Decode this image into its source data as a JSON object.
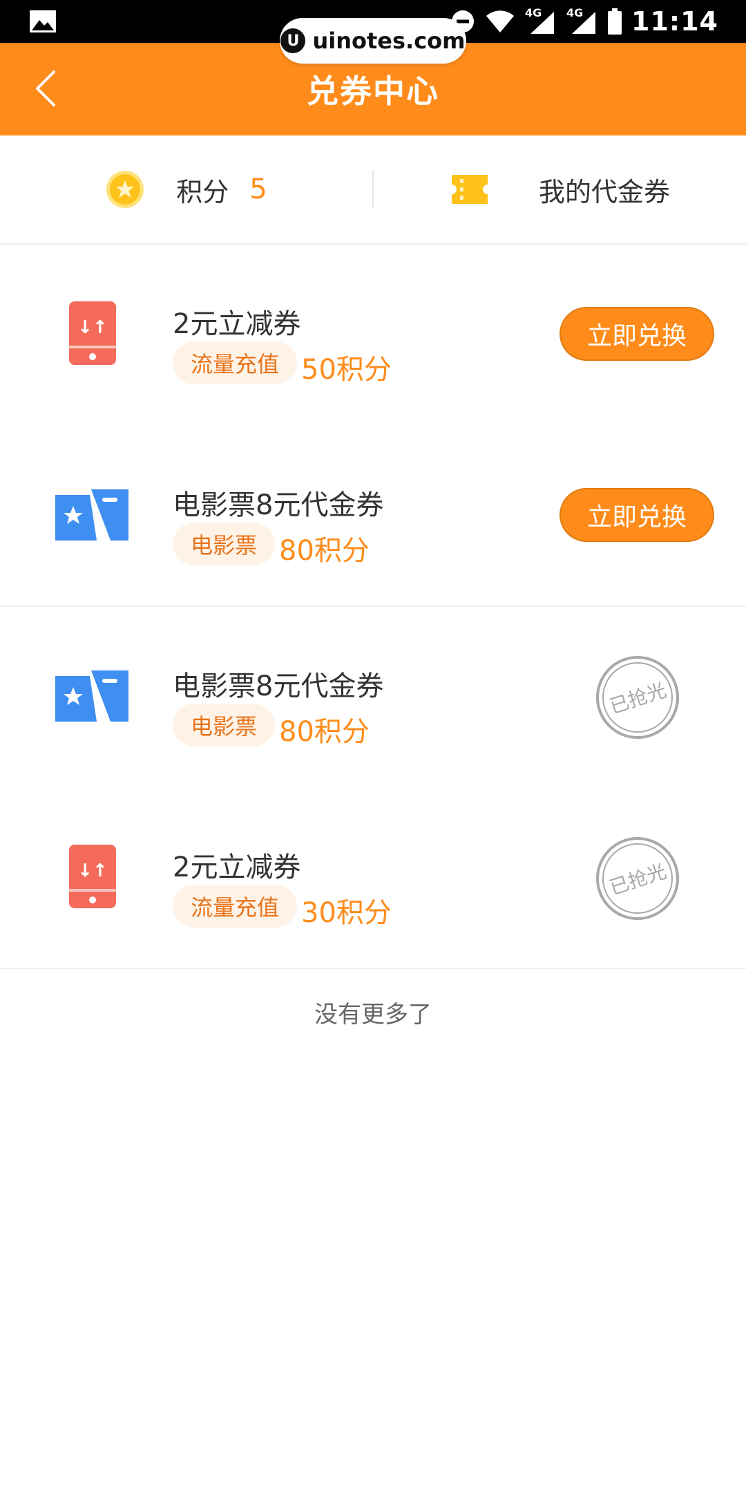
{
  "status_bar": {
    "time": "11:14",
    "network_1": "4G",
    "network_2": "4G"
  },
  "watermark": {
    "logo": "U",
    "text": "uinotes.com"
  },
  "header": {
    "title": "兑券中心",
    "back_icon": "chevron-left-icon"
  },
  "points": {
    "label": "积分",
    "value": "5",
    "voucher_label": "我的代金券"
  },
  "items": [
    {
      "title": "2元立减券",
      "tag": "流量充值",
      "cost": "50积分",
      "action": "立即兑换",
      "status": "available",
      "icon": "phone-data-icon"
    },
    {
      "title": "电影票8元代金券",
      "tag": "电影票",
      "cost": "80积分",
      "action": "立即兑换",
      "status": "available",
      "icon": "movie-ticket-icon"
    },
    {
      "title": "电影票8元代金券",
      "tag": "电影票",
      "cost": "80积分",
      "action": "已抢光",
      "status": "sold-out",
      "icon": "movie-ticket-icon"
    },
    {
      "title": "2元立减券",
      "tag": "流量充值",
      "cost": "30积分",
      "action": "已抢光",
      "status": "sold-out",
      "icon": "phone-data-icon"
    }
  ],
  "footer": {
    "no_more": "没有更多了"
  },
  "colors": {
    "brand": "#ff8c1a",
    "tag_bg": "#fff3e8",
    "tag_text": "#e8731a",
    "phone_icon": "#f56b5b",
    "movie_icon": "#3f8ff2"
  }
}
